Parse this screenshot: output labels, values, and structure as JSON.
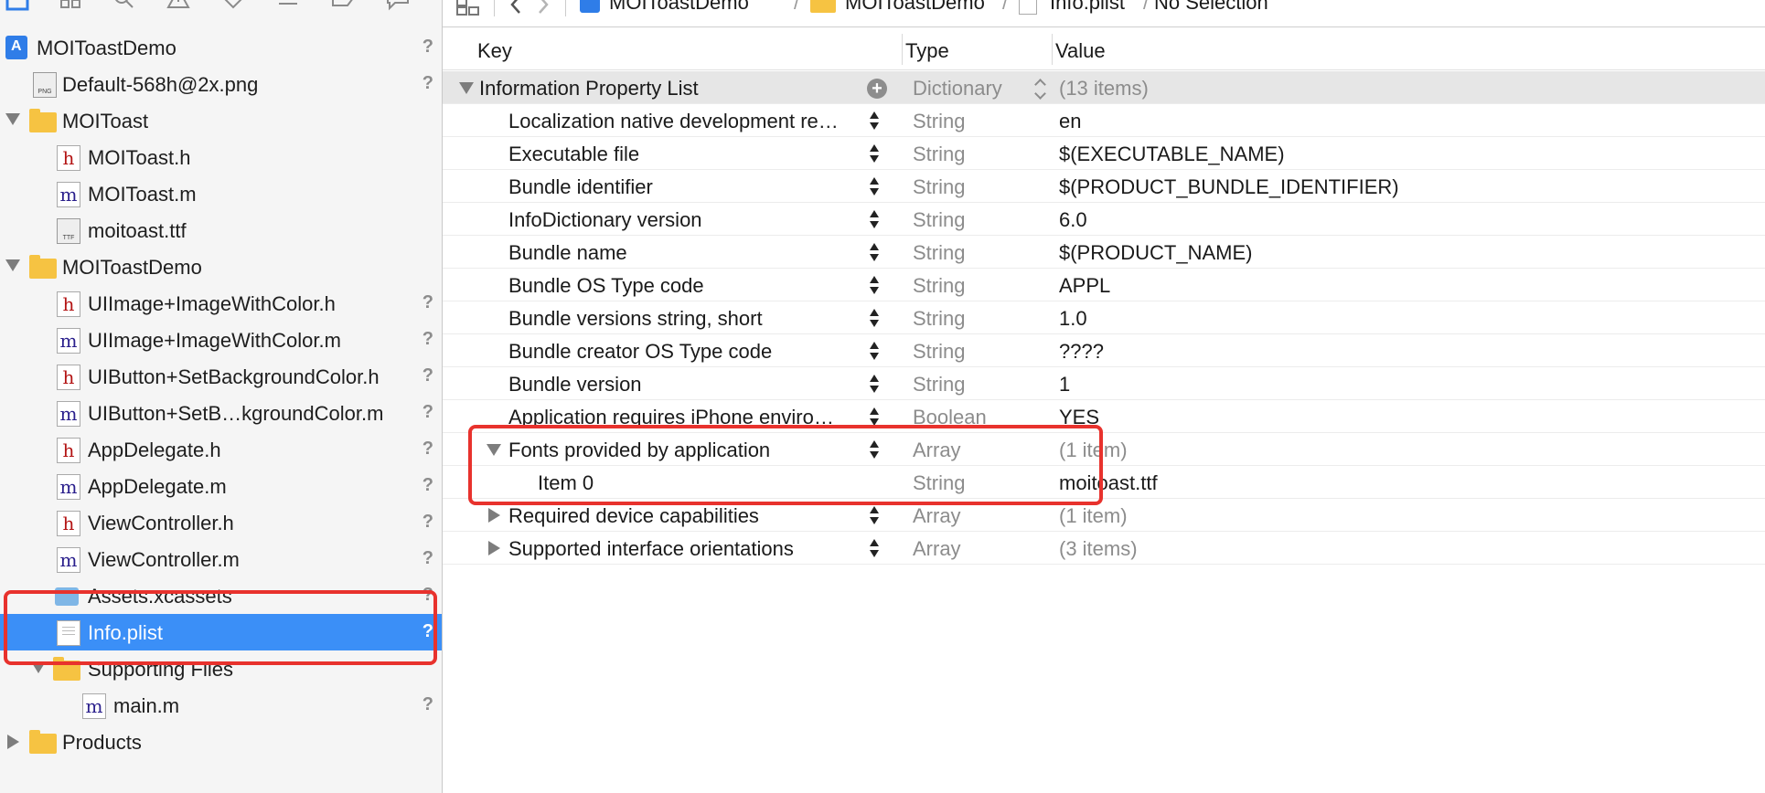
{
  "colors": {
    "selection": "#3b8ff7",
    "highlight": "#e8322d",
    "folder": "#f6c342"
  },
  "navigator": {
    "toolbar_icons": [
      "project-navigator-icon",
      "symbol-navigator-icon",
      "find-icon",
      "issue-icon",
      "test-icon",
      "debug-icon",
      "breakpoint-icon",
      "report-icon"
    ],
    "items": [
      {
        "label": "MOIToastDemo",
        "icon": "project-icon",
        "status": "?"
      },
      {
        "label": "Default-568h@2x.png",
        "icon": "png-file-icon",
        "status": "?"
      },
      {
        "label": "MOIToast",
        "icon": "folder-icon",
        "status": ""
      },
      {
        "label": "MOIToast.h",
        "icon": "header-file-icon",
        "status": ""
      },
      {
        "label": "MOIToast.m",
        "icon": "source-file-icon",
        "status": ""
      },
      {
        "label": "moitoast.ttf",
        "icon": "ttf-file-icon",
        "status": ""
      },
      {
        "label": "MOIToastDemo",
        "icon": "folder-icon",
        "status": ""
      },
      {
        "label": "UIImage+ImageWithColor.h",
        "icon": "header-file-icon",
        "status": "?"
      },
      {
        "label": "UIImage+ImageWithColor.m",
        "icon": "source-file-icon",
        "status": "?"
      },
      {
        "label": "UIButton+SetBackgroundColor.h",
        "icon": "header-file-icon",
        "status": "?"
      },
      {
        "label": "UIButton+SetB…kgroundColor.m",
        "icon": "source-file-icon",
        "status": "?"
      },
      {
        "label": "AppDelegate.h",
        "icon": "header-file-icon",
        "status": "?"
      },
      {
        "label": "AppDelegate.m",
        "icon": "source-file-icon",
        "status": "?"
      },
      {
        "label": "ViewController.h",
        "icon": "header-file-icon",
        "status": "?"
      },
      {
        "label": "ViewController.m",
        "icon": "source-file-icon",
        "status": "?"
      },
      {
        "label": "Assets.xcassets",
        "icon": "assets-icon",
        "status": "?"
      },
      {
        "label": "Info.plist",
        "icon": "plist-file-icon",
        "status": "?",
        "selected": true
      },
      {
        "label": "Supporting Files",
        "icon": "folder-icon",
        "status": ""
      },
      {
        "label": "main.m",
        "icon": "source-file-icon",
        "status": "?"
      },
      {
        "label": "Products",
        "icon": "folder-icon",
        "status": ""
      }
    ]
  },
  "jumpbar": {
    "crumbs": [
      "MOIToastDemo",
      "MOIToastDemo",
      "Info.plist",
      "No Selection"
    ]
  },
  "plist": {
    "headers": {
      "key": "Key",
      "type": "Type",
      "value": "Value"
    },
    "root": {
      "key": "Information Property List",
      "type": "Dictionary",
      "value": "(13 items)"
    },
    "rows": [
      {
        "key": "Localization native development re…",
        "type": "String",
        "value": "en"
      },
      {
        "key": "Executable file",
        "type": "String",
        "value": "$(EXECUTABLE_NAME)"
      },
      {
        "key": "Bundle identifier",
        "type": "String",
        "value": "$(PRODUCT_BUNDLE_IDENTIFIER)"
      },
      {
        "key": "InfoDictionary version",
        "type": "String",
        "value": "6.0"
      },
      {
        "key": "Bundle name",
        "type": "String",
        "value": "$(PRODUCT_NAME)"
      },
      {
        "key": "Bundle OS Type code",
        "type": "String",
        "value": "APPL"
      },
      {
        "key": "Bundle versions string, short",
        "type": "String",
        "value": "1.0"
      },
      {
        "key": "Bundle creator OS Type code",
        "type": "String",
        "value": "????"
      },
      {
        "key": "Bundle version",
        "type": "String",
        "value": "1"
      },
      {
        "key": "Application requires iPhone enviro…",
        "type": "Boolean",
        "value": "YES"
      },
      {
        "key": "Fonts provided by application",
        "type": "Array",
        "value": "(1 item)"
      },
      {
        "key": "Item 0",
        "type": "String",
        "value": "moitoast.ttf"
      },
      {
        "key": "Required device capabilities",
        "type": "Array",
        "value": "(1 item)"
      },
      {
        "key": "Supported interface orientations",
        "type": "Array",
        "value": "(3 items)"
      }
    ]
  }
}
